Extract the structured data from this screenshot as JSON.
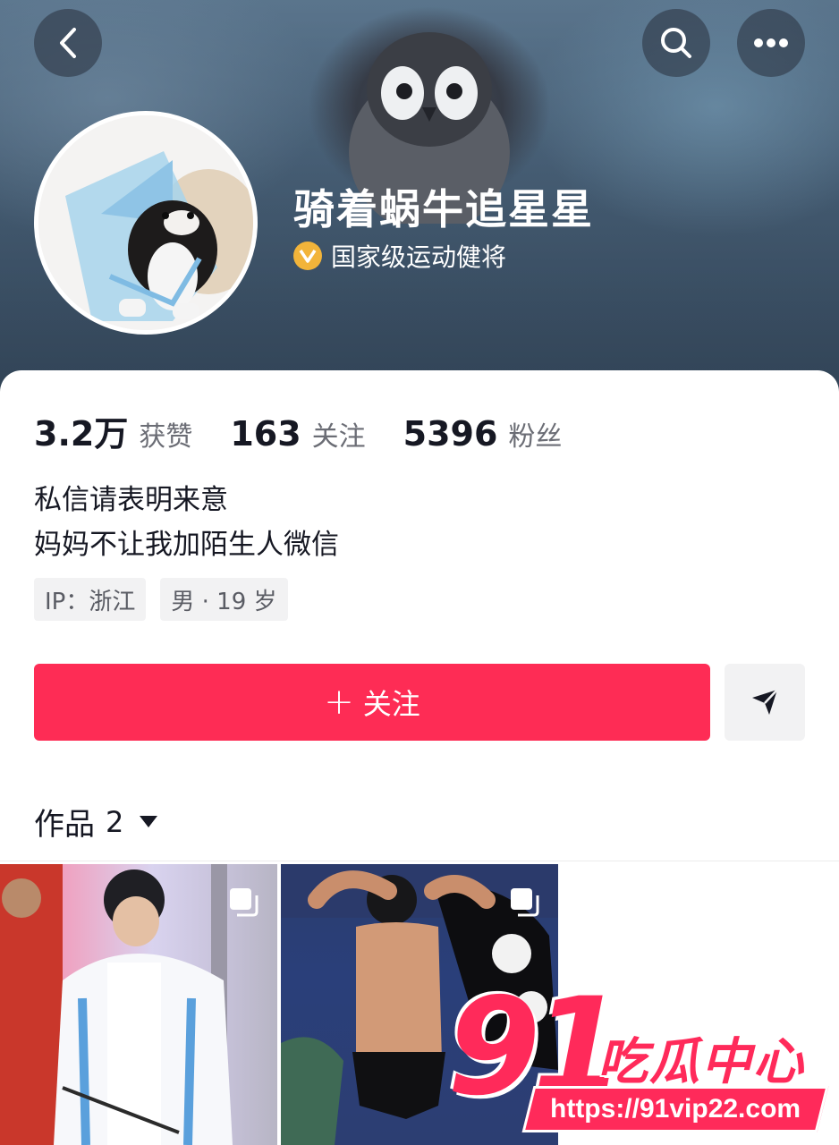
{
  "profile": {
    "nickname": "骑着蜗牛追星星",
    "certification": "国家级运动健将",
    "stats": [
      {
        "value": "3.2万",
        "label": "获赞"
      },
      {
        "value": "163",
        "label": "关注"
      },
      {
        "value": "5396",
        "label": "粉丝"
      }
    ],
    "bio_lines": [
      "私信请表明来意",
      "妈妈不让我加陌生人微信"
    ],
    "tags": [
      "IP：浙江",
      "男 · 19 岁"
    ]
  },
  "actions": {
    "follow_label": "关注"
  },
  "works": {
    "label": "作品",
    "count": "2"
  },
  "icons": {
    "back": "chevron-left-icon",
    "search": "search-icon",
    "more": "more-dots-icon",
    "message": "send-message-icon",
    "multi_image": "multi-image-icon"
  },
  "colors": {
    "accent": "#fe2c55",
    "badge": "#f2b43a"
  },
  "watermark": {
    "number": "91",
    "text": "吃瓜中心",
    "url": "https://91vip22.com"
  }
}
